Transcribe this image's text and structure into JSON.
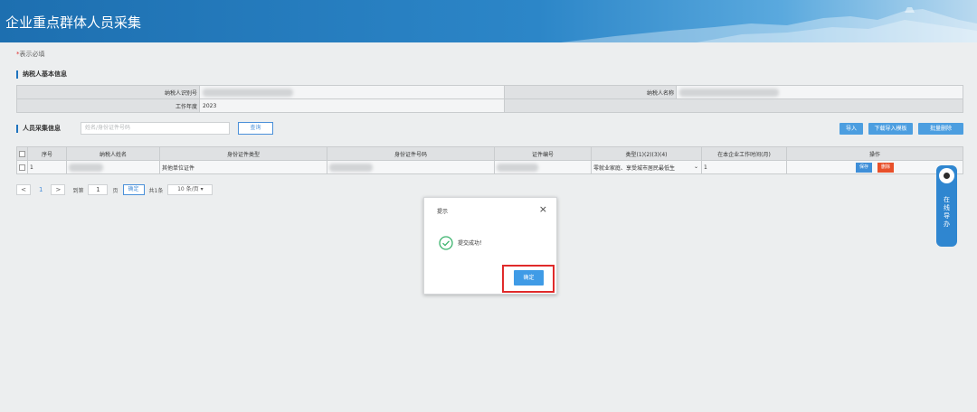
{
  "header": {
    "title": "企业重点群体人员采集"
  },
  "required_note": {
    "star": "*",
    "text": "表示必填"
  },
  "basic_info": {
    "section_title": "纳税人基本信息",
    "taxpayer_id_label": "纳税人识别号",
    "taxpayer_name_label": "纳税人名称",
    "work_year_label": "工作年度",
    "work_year_value": "2023"
  },
  "collection": {
    "section_title": "人员采集信息",
    "search_placeholder": "姓名/身份证件号码",
    "query_label": "查询",
    "import_label": "导入",
    "download_template_label": "下载导入模板",
    "batch_delete_label": "批量删除"
  },
  "table": {
    "columns": [
      "序号",
      "纳税人姓名",
      "身份证件类型",
      "身份证件号码",
      "证件编号",
      "类型(1)(2)(3)(4)",
      "在本企业工作时间(月)",
      "操作"
    ],
    "rows": [
      {
        "index": "1",
        "id_type": "其他单位证件",
        "category": "零就业家庭、享受城市居民最低生",
        "months": "1",
        "save_label": "保存",
        "delete_label": "删除"
      }
    ]
  },
  "pager": {
    "prev": "<",
    "current_page": "1",
    "next": ">",
    "goto_label": "到第",
    "goto_value": "1",
    "page_suffix": "页",
    "confirm_label": "确定",
    "total": "共1条",
    "page_size": "10 条/页",
    "page_size_caret": "▾"
  },
  "dialog": {
    "title": "提示",
    "close": "×",
    "message": "提交成功！",
    "ok_label": "确定"
  },
  "help_widget": {
    "text": "在线导办"
  },
  "colors": {
    "primary": "#3f9be6",
    "header": "#1d6fb0",
    "danger": "#e8502a",
    "highlight": "#e02a2a",
    "success": "#3cb46e"
  }
}
